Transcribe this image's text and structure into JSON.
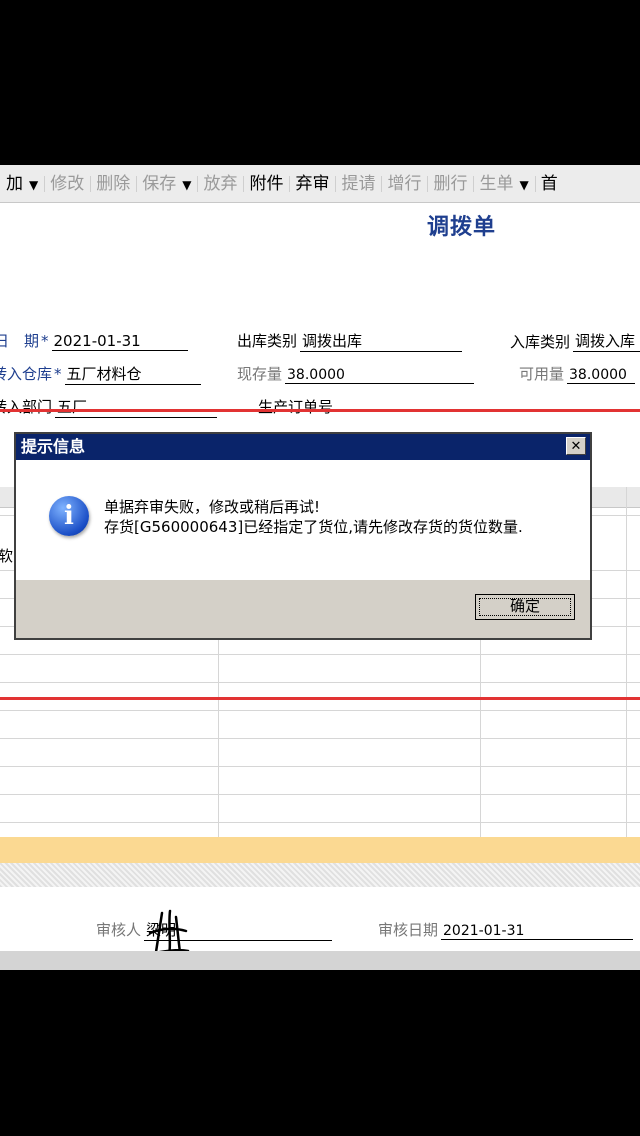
{
  "toolbar": {
    "items": [
      {
        "label": "加",
        "disabled": false,
        "dropdown": true
      },
      {
        "label": "修改",
        "disabled": true
      },
      {
        "label": "删除",
        "disabled": true
      },
      {
        "label": "保存",
        "disabled": true,
        "dropdown": true
      },
      {
        "label": "放弃",
        "disabled": true
      },
      {
        "label": "附件",
        "disabled": false
      },
      {
        "label": "弃审",
        "disabled": false
      },
      {
        "label": "提请",
        "disabled": true
      },
      {
        "label": "增行",
        "disabled": true
      },
      {
        "label": "删行",
        "disabled": true
      },
      {
        "label": "生单",
        "disabled": true,
        "dropdown": true
      },
      {
        "label": "首",
        "disabled": false
      }
    ]
  },
  "form": {
    "title": "调拨单",
    "date_label": "日　期",
    "date_value": "2021-01-31",
    "out_type_label": "出库类别",
    "out_type_value": "调拨出库",
    "in_type_label": "入库类别",
    "in_type_value": "调拨入库",
    "in_warehouse_label": "转入仓库",
    "in_warehouse_value": "五厂材料仓",
    "stock_label": "现存量",
    "stock_value": "38.0000",
    "available_label": "可用量",
    "available_value": "38.0000",
    "in_dept_label": "转入部门",
    "in_dept_value": "五厂",
    "prod_order_label": "生产订单号",
    "prod_order_value": ""
  },
  "grid": {
    "partial_cell": "软"
  },
  "footer": {
    "auditor_label": "审核人",
    "auditor_value": "梁明",
    "audit_date_label": "审核日期",
    "audit_date_value": "2021-01-31"
  },
  "dialog": {
    "title": "提示信息",
    "close_symbol": "✕",
    "icon": "info-icon",
    "message_line1": "单据弃审失败，修改或稍后再试!",
    "message_line2": "存货[G560000643]已经指定了货位,请先修改存货的货位数量.",
    "ok_label": "确定"
  },
  "colors": {
    "label_blue": "#1f3f8f",
    "title_bar": "#0a246a",
    "red_line": "#e23333",
    "summary_row": "#fbd992"
  }
}
